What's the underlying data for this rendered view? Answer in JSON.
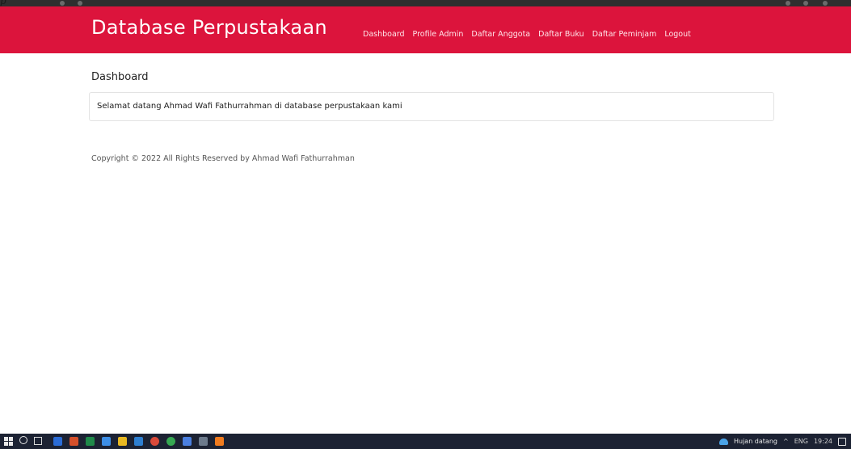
{
  "browser": {
    "corner_glyph": "p"
  },
  "navbar": {
    "brand": "Database Perpustakaan",
    "links": [
      "Dashboard",
      "Profile Admin",
      "Daftar Anggota",
      "Daftar Buku",
      "Daftar Peminjam",
      "Logout"
    ],
    "background_color": "#dc143c"
  },
  "main": {
    "page_title": "Dashboard",
    "welcome_text": "Selamat datang Ahmad Wafi Fathurrahman di database perpustakaan kami"
  },
  "footer": {
    "copyright": "Copyright © 2022 All Rights Reserved by Ahmad Wafi Fathurrahman"
  },
  "taskbar": {
    "icons": [
      "windows-start-icon",
      "search-icon",
      "task-view-icon",
      "word-icon",
      "powerpoint-icon",
      "excel-icon",
      "photos-icon",
      "file-explorer-icon",
      "vscode-icon",
      "chrome-icon",
      "chrome-alt-icon",
      "security-icon",
      "app-icon",
      "store-icon"
    ],
    "tray": {
      "weather_text": "Hujan datang",
      "chevron": "^",
      "language": "ENG",
      "time": "19:24"
    }
  }
}
